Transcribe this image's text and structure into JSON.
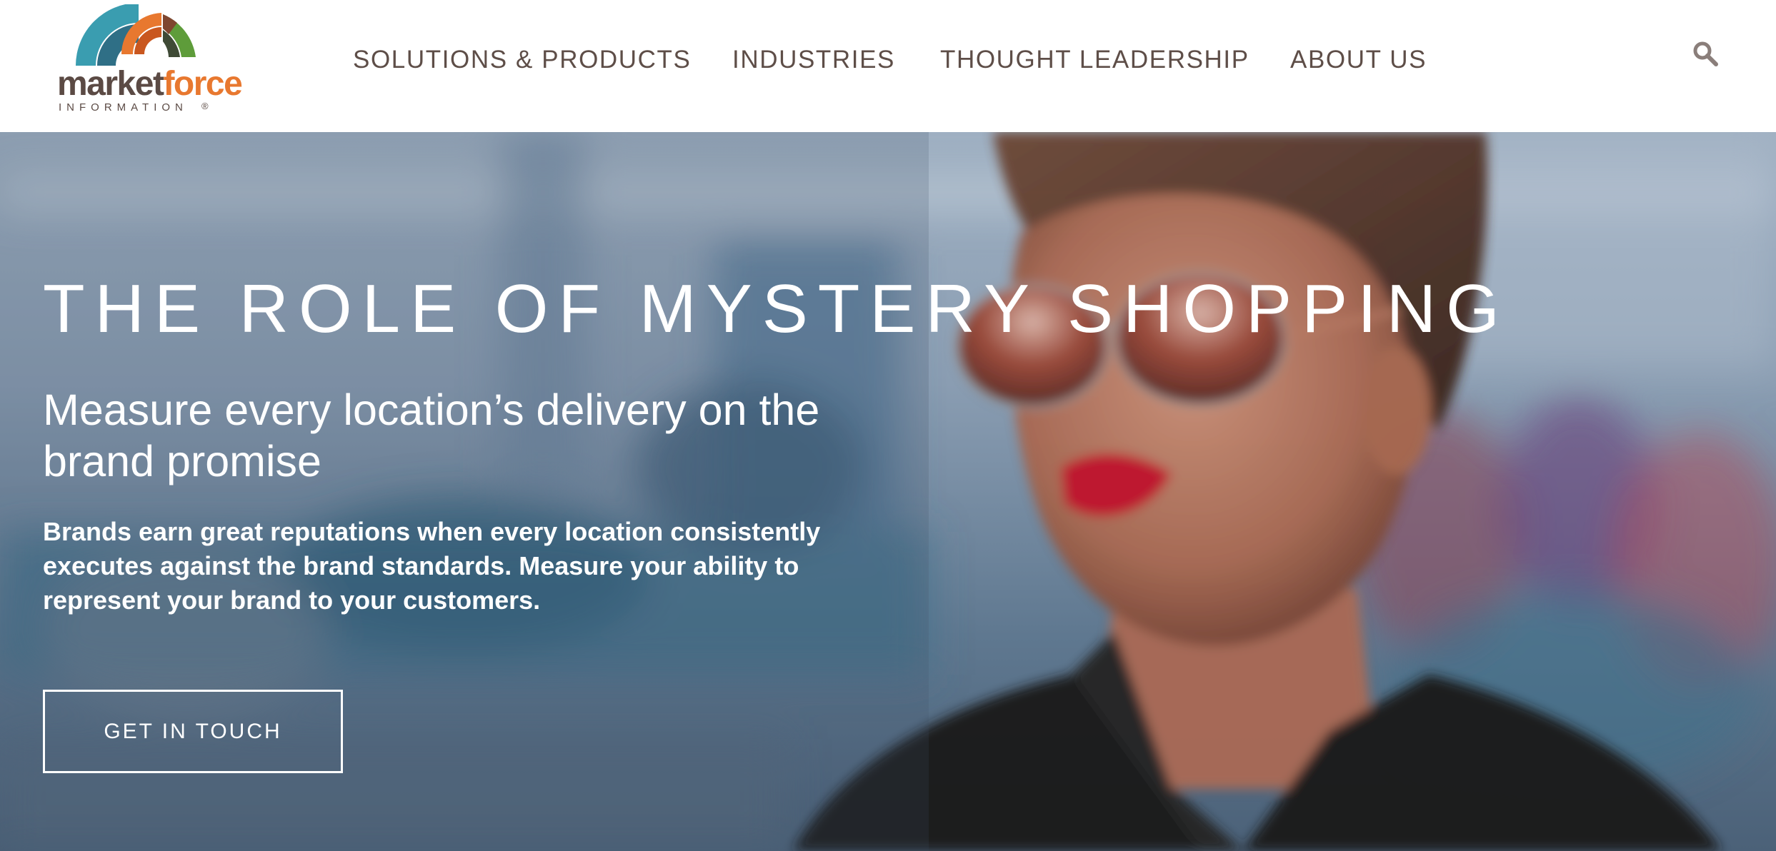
{
  "header": {
    "logo": {
      "word_part1": "market",
      "word_part2": "force",
      "tagline": "INFORMATION",
      "registered": "®"
    },
    "nav": [
      {
        "label": "SOLUTIONS & PRODUCTS"
      },
      {
        "label": "INDUSTRIES"
      },
      {
        "label": "THOUGHT LEADERSHIP"
      },
      {
        "label": "ABOUT US"
      }
    ],
    "search_icon": "search-icon"
  },
  "hero": {
    "title": "THE ROLE OF MYSTERY SHOPPING",
    "subtitle": "Measure every location’s delivery on the brand promise",
    "body": "Brands earn great reputations when every location consistently executes against the brand standards. Measure your ability to represent your brand to your customers.",
    "cta_label": "GET IN TOUCH"
  },
  "colors": {
    "brand_brown": "#5b4a44",
    "brand_orange": "#e8782f",
    "brand_teal": "#3a9db0",
    "brand_green": "#5e9c3a",
    "nav_text": "#5e4e48",
    "hero_text": "#ffffff"
  }
}
